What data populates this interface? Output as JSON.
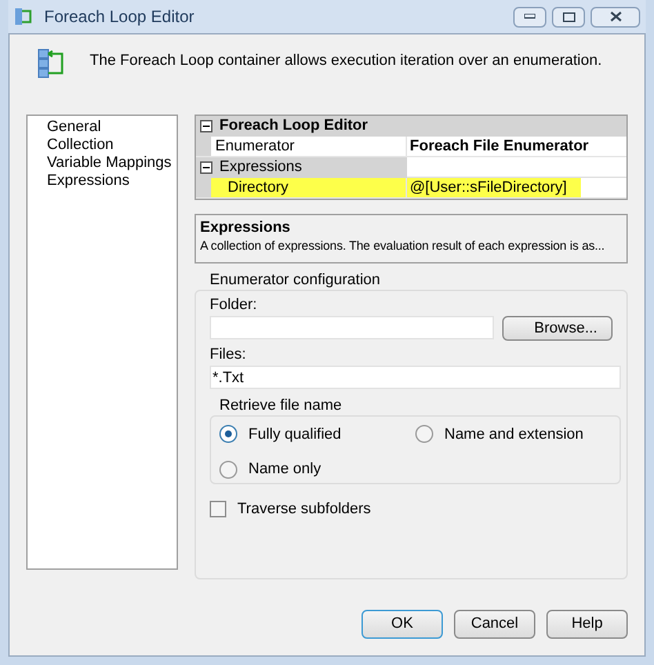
{
  "window": {
    "title": "Foreach Loop Editor"
  },
  "header": {
    "description": "The Foreach Loop container allows execution iteration over an enumeration."
  },
  "nav": {
    "items": [
      {
        "label": "General"
      },
      {
        "label": "Collection"
      },
      {
        "label": "Variable Mappings"
      },
      {
        "label": "Expressions"
      }
    ]
  },
  "property_grid": {
    "rows": [
      {
        "kind": "category",
        "label": "Foreach Loop Editor",
        "expanded": true
      },
      {
        "kind": "property",
        "label": "Enumerator",
        "value": "Foreach File Enumerator",
        "bold": true,
        "highlighted": false
      },
      {
        "kind": "category",
        "label": "Expressions",
        "expanded": true
      },
      {
        "kind": "property",
        "label": "Directory",
        "value": "@[User::sFileDirectory]",
        "bold": false,
        "highlighted": true
      }
    ]
  },
  "description": {
    "title": "Expressions",
    "text": "A collection of expressions. The evaluation result of each expression is as..."
  },
  "enumerator_configuration": {
    "title": "Enumerator configuration",
    "folder_label": "Folder:",
    "browse_button": "Browse...",
    "files_label": "Files:",
    "files_value": "*.Txt",
    "retrieve": {
      "title": "Retrieve file name",
      "options": [
        {
          "label": "Fully qualified",
          "selected": true
        },
        {
          "label": "Name and extension",
          "selected": false
        },
        {
          "label": "Name only",
          "selected": false
        }
      ]
    },
    "traverse": {
      "label": "Traverse subfolders",
      "checked": false
    }
  },
  "buttons": [
    {
      "label": "OK",
      "default": true
    },
    {
      "label": "Cancel",
      "default": false
    },
    {
      "label": "Help",
      "default": false
    }
  ]
}
